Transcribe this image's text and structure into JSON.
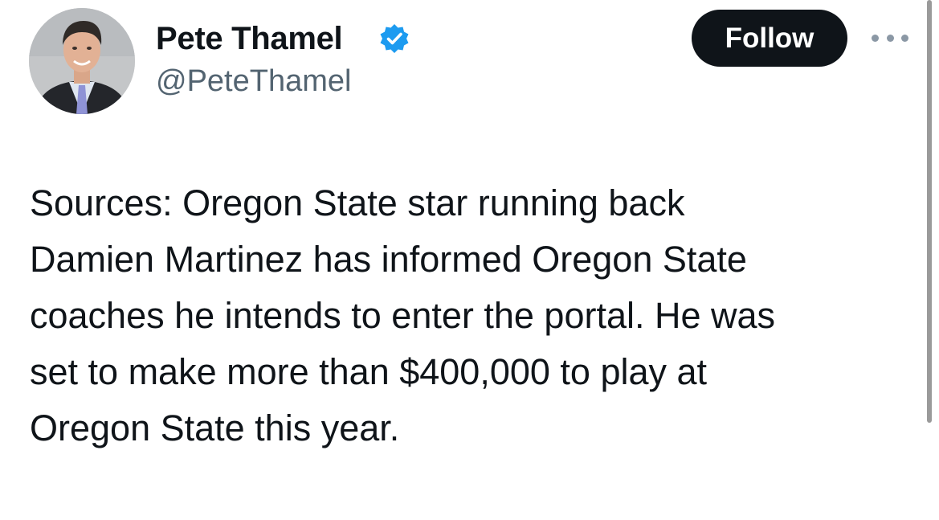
{
  "author": {
    "display_name": "Pete Thamel",
    "handle": "@PeteThamel",
    "verified_icon": "verified-badge-icon",
    "verified_color": "#1d9bf0"
  },
  "actions": {
    "follow_label": "Follow",
    "more_icon": "more-options-icon"
  },
  "tweet": {
    "lines": [
      "Sources: Oregon State star running back",
      "Damien Martinez has informed Oregon State",
      "coaches he intends to enter the portal. He was",
      "set to make more than $400,000 to play at",
      "Oregon State this year."
    ]
  },
  "colors": {
    "text": "#0f1419",
    "secondary_text": "#536471",
    "button_bg": "#0f1419",
    "button_text": "#ffffff"
  }
}
